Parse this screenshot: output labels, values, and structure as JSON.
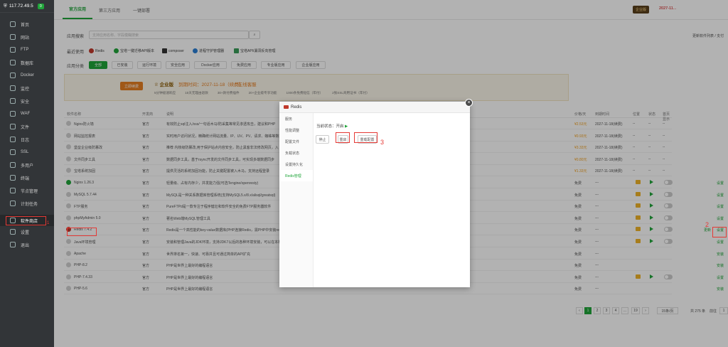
{
  "sidebar": {
    "host": "117.72.49.5",
    "count": "0",
    "items": [
      {
        "label": "首页",
        "icon": "home-icon"
      },
      {
        "label": "网站",
        "icon": "globe-icon"
      },
      {
        "label": "FTP",
        "icon": "ftp-icon"
      },
      {
        "label": "数据库",
        "icon": "database-icon"
      },
      {
        "label": "Docker",
        "icon": "docker-icon"
      },
      {
        "label": "监控",
        "icon": "monitor-icon"
      },
      {
        "label": "安全",
        "icon": "shield-icon"
      },
      {
        "label": "WAF",
        "icon": "waf-icon"
      },
      {
        "label": "文件",
        "icon": "folder-icon"
      },
      {
        "label": "日志",
        "icon": "log-icon"
      },
      {
        "label": "SSL",
        "icon": "ssl-icon"
      },
      {
        "label": "多用户",
        "icon": "users-icon"
      },
      {
        "label": "终端",
        "icon": "terminal-icon"
      },
      {
        "label": "节点管理",
        "icon": "node-icon"
      },
      {
        "label": "计划任务",
        "icon": "clock-icon"
      },
      {
        "label": "软件商店",
        "icon": "grid-icon"
      },
      {
        "label": "设置",
        "icon": "gear-icon"
      },
      {
        "label": "退出",
        "icon": "logout-icon"
      }
    ]
  },
  "tabs": [
    "官方应用",
    "第三方应用",
    "一键部署"
  ],
  "enterprise": {
    "badge": "企业版",
    "expire": "2027-11..."
  },
  "search": {
    "label": "应用搜索",
    "placeholder": "支持应用名称、字段模糊搜索",
    "right_text": "更新软件列表 / 支付"
  },
  "recent": {
    "label": "最近使用",
    "items": [
      "Redis",
      "宝塔一键迁移API版本",
      "composer",
      "进程守护管理器",
      "宝塔API/漏洞反向管理"
    ]
  },
  "categories": {
    "label": "应用分类",
    "items": [
      "全部",
      "已安装",
      "运行环境",
      "安全应用",
      "Docker应用",
      "免费应用",
      "专业版应用",
      "企业版应用"
    ]
  },
  "banner": {
    "btn": "立即续费",
    "title": "企业版",
    "expire": "到期时间：2027-11-18（续费）",
    "consult": "在线客服",
    "features": [
      "5分钟极速响应",
      "15天无理由退款",
      "30+款付费插件",
      "20+企业级专享功能",
      "1000条免费短信（年付）",
      "2张SSL商用证书（年付）"
    ]
  },
  "table": {
    "headers": [
      "软件名称",
      "开发商",
      "说明",
      "价格/天",
      "到期时间",
      "位置",
      "状态",
      "首页显示"
    ],
    "rows": [
      {
        "name": "Nginx防火墙",
        "dev": "官方",
        "desc": "有效防止sql注入/xss/一句话木马/防采集等常见渗透攻击，建议和PHP",
        "price": "¥2.53元",
        "expire": "2027-11-18(续费)",
        "pos": "--",
        "st": "--",
        "show": "--",
        "kind": "paid"
      },
      {
        "name": "网站监控报表",
        "dev": "官方",
        "desc": "实时用户访问状况，精确统计网站流量、IP、UV、PV、请求、蜘蛛等数据",
        "price": "¥0.93元",
        "expire": "2027-11-18(续费)",
        "pos": "--",
        "st": "--",
        "show": "--",
        "kind": "paid"
      },
      {
        "name": "堡垒企业级防篡改",
        "dev": "官方",
        "desc": "推荐 内核级防篡改,用于保护站点内容安全，防止黑客非法修改网页，入",
        "price": "¥3.33元",
        "expire": "2027-11-18(续费)",
        "pos": "--",
        "st": "--",
        "show": "--",
        "kind": "paid"
      },
      {
        "name": "文件同步工具",
        "dev": "官方",
        "desc": "数据同步工具，基于rsync开发的文件同步工具，可实现多端数据同步",
        "price": "¥0.80元",
        "expire": "2027-11-18(续费)",
        "pos": "--",
        "st": "--",
        "show": "--",
        "kind": "paid"
      },
      {
        "name": "宝塔系统加固",
        "dev": "官方",
        "desc": "提供灵活的系统加固功能，防止关键配置被入木马，支持远程登录",
        "price": "¥1.33元",
        "expire": "2027-11-18(续费)",
        "pos": "--",
        "st": "--",
        "show": "--",
        "kind": "paid"
      },
      {
        "name": "Nginx 1.26.3",
        "dev": "官方",
        "desc": "轻量级、占有内存少，并发能力强(可选Tengine/openresty)",
        "price": "免费",
        "expire": "---",
        "pos": "",
        "st": "",
        "show": "",
        "kind": "free",
        "action": "设置"
      },
      {
        "name": "MySQL 5.7.44",
        "dev": "官方",
        "desc": "MySQL是一种关系数据库管理系统(支持MySQL5.x/8.x/alisql/greatsql)",
        "price": "免费",
        "expire": "---",
        "pos": "",
        "st": "",
        "show": "",
        "kind": "free",
        "action": "设置"
      },
      {
        "name": "FTP服务",
        "dev": "官方",
        "desc": "PureFTPd是一款专注于程序健壮和软件安全的免费FTP服务器软件",
        "price": "免费",
        "expire": "---",
        "pos": "",
        "st": "",
        "show": "",
        "kind": "free",
        "action": "设置"
      },
      {
        "name": "phpMyAdmin 5.0",
        "dev": "官方",
        "desc": "著名Web端MySQL管理工具",
        "price": "免费",
        "expire": "---",
        "pos": "",
        "st": "",
        "show": "",
        "kind": "free",
        "action": "设置"
      },
      {
        "name": "Redis 7.4.2",
        "dev": "官方",
        "desc": "Redis是一个高性能的key-value数据库(PHP连接Redis，需PHP中安装redis扩展)",
        "price": "免费",
        "expire": "---",
        "pos": "",
        "st": "",
        "show": "",
        "kind": "free",
        "action": "设置",
        "update": "更新"
      },
      {
        "name": "Java环境管理",
        "dev": "官方",
        "desc": "安装和管理Java的JDK环境，支持JDK7以后的各种环境安装，可以在本机",
        "price": "免费",
        "expire": "---",
        "pos": "",
        "st": "",
        "show": "",
        "kind": "free",
        "action": "设置"
      },
      {
        "name": "Apache",
        "dev": "官方",
        "desc": "世界排名第一，快速、可靠并且可通过简单的API扩充",
        "price": "免费",
        "expire": "---",
        "pos": "",
        "st": "",
        "show": "",
        "kind": "free",
        "action": "安装"
      },
      {
        "name": "PHP-8.2",
        "dev": "官方",
        "desc": "PHP是世界上最好的编程语言",
        "price": "免费",
        "expire": "---",
        "pos": "",
        "st": "",
        "show": "",
        "kind": "free",
        "action": "安装"
      },
      {
        "name": "PHP-7.4.33",
        "dev": "官方",
        "desc": "PHP是世界上最好的编程语言",
        "price": "免费",
        "expire": "---",
        "pos": "",
        "st": "",
        "show": "",
        "kind": "free",
        "action": "设置"
      },
      {
        "name": "PHP-5.6",
        "dev": "官方",
        "desc": "PHP是世界上最好的编程语言",
        "price": "免费",
        "expire": "---",
        "pos": "",
        "st": "",
        "show": "",
        "kind": "free",
        "action": "安装"
      }
    ]
  },
  "pagination": {
    "pages": [
      "1",
      "2",
      "3",
      "4",
      "...",
      "19"
    ],
    "per_page": "15条/页",
    "total": "共 275 条",
    "goto_label": "前往",
    "goto_value": "1"
  },
  "modal": {
    "title": "Redis",
    "menu": [
      "服务",
      "性能调整",
      "配置文件",
      "负载状态",
      "设置持久化",
      "Redis管理"
    ],
    "status_label": "当前状态：开启",
    "buttons": [
      "停止",
      "重启",
      "重载配置"
    ]
  },
  "annotations": [
    "1",
    "2",
    "3"
  ],
  "colors": {
    "accent": "#20a53a",
    "sidebar": "#323538",
    "annotation": "#e53935",
    "paid": "#f0a020"
  }
}
